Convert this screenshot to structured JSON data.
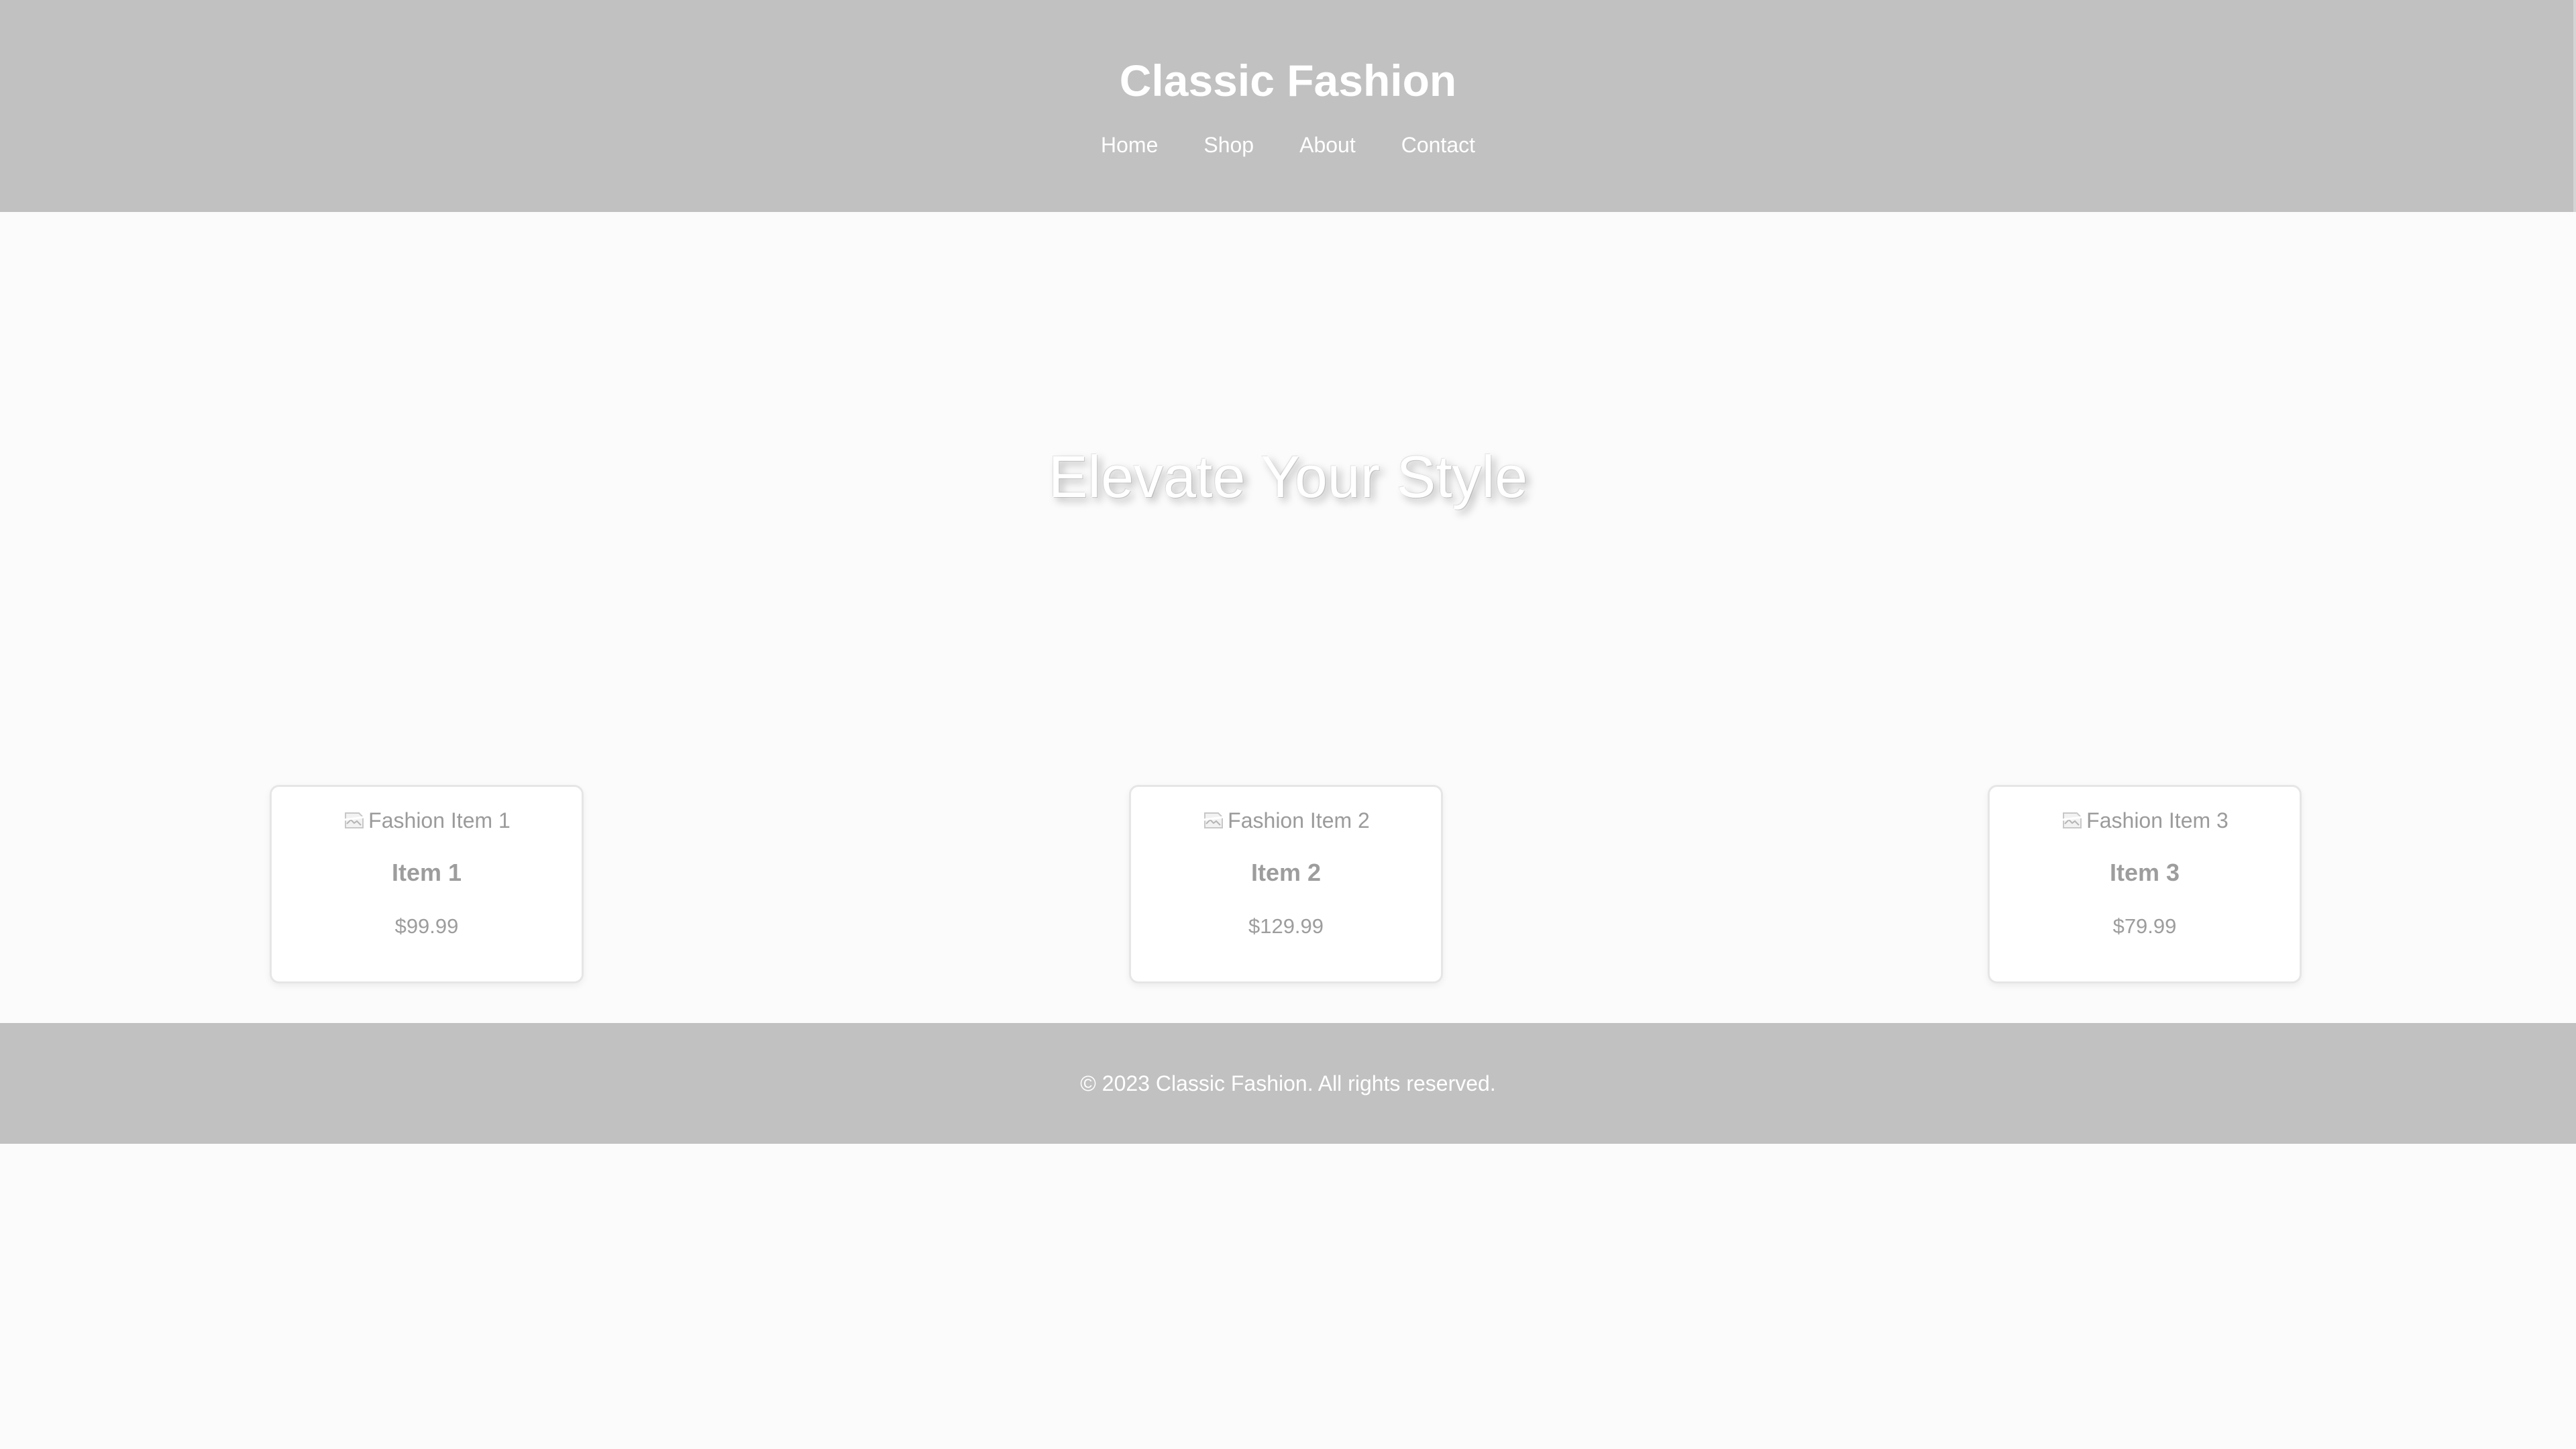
{
  "header": {
    "title": "Classic Fashion",
    "nav": [
      {
        "label": "Home"
      },
      {
        "label": "Shop"
      },
      {
        "label": "About"
      },
      {
        "label": "Contact"
      }
    ]
  },
  "hero": {
    "title": "Elevate Your Style"
  },
  "products": [
    {
      "image_alt": "Fashion Item 1",
      "name": "Item 1",
      "price": "$99.99",
      "icon": "broken-image-icon"
    },
    {
      "image_alt": "Fashion Item 2",
      "name": "Item 2",
      "price": "$129.99",
      "icon": "broken-image-icon"
    },
    {
      "image_alt": "Fashion Item 3",
      "name": "Item 3",
      "price": "$79.99",
      "icon": "broken-image-icon"
    }
  ],
  "footer": {
    "text": "© 2023 Classic Fashion. All rights reserved."
  },
  "colors": {
    "header_bg": "#c1c1c1",
    "page_bg": "#fbfbfb",
    "muted_text": "#9d9d9d",
    "header_text": "#ffffff"
  }
}
